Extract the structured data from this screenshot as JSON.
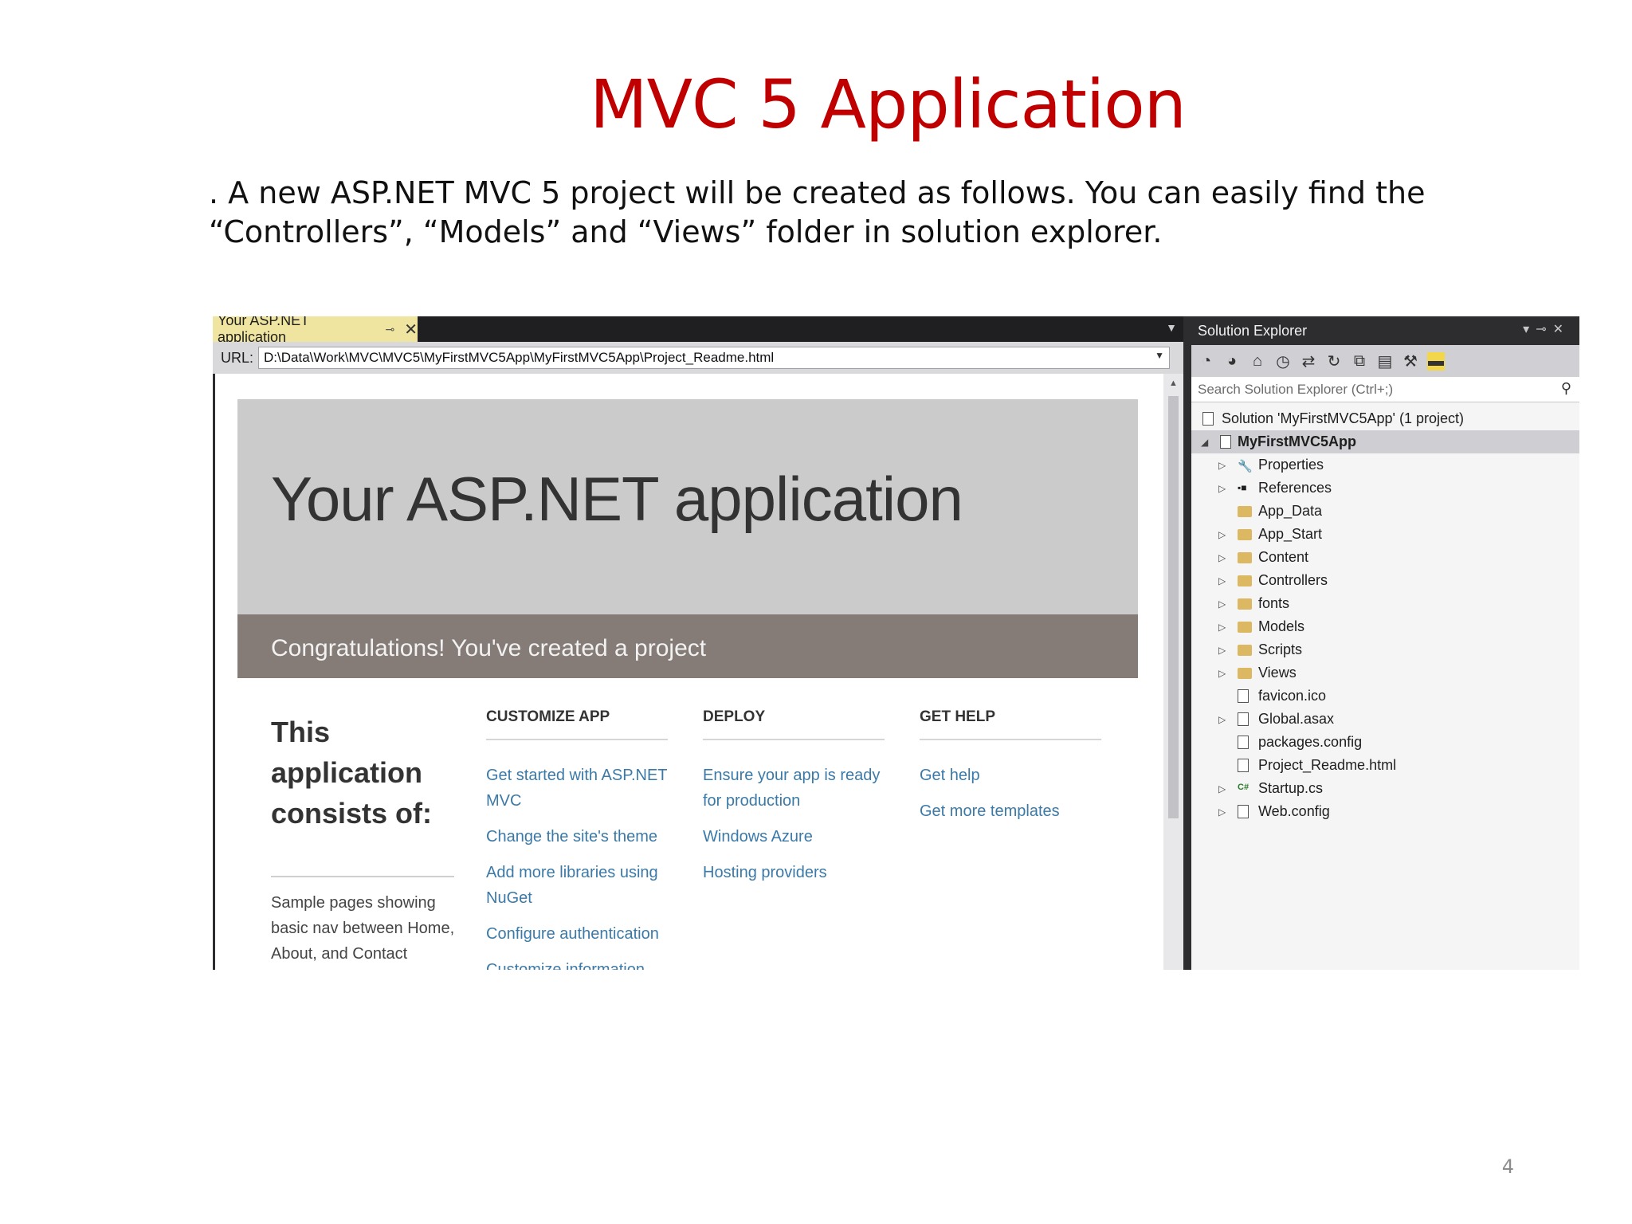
{
  "slide": {
    "title": "MVC 5 Application",
    "body_line1": ". A new ASP.NET MVC 5 project will be created as follows. You can easily find the",
    "body_line2": "“Controllers”, “Models” and “Views” folder in solution explorer.",
    "page_number": "4"
  },
  "document": {
    "tab_label": "Your ASP.NET application",
    "url_label": "URL:",
    "url_value": "D:\\Data\\Work\\MVC\\MVC5\\MyFirstMVC5App\\MyFirstMVC5App\\Project_Readme.html"
  },
  "page": {
    "hero_title": "Your ASP.NET application",
    "hero_subtitle": "Congratulations! You've created a project",
    "consists_title": "This application consists of:",
    "consists_desc": "Sample pages showing basic nav between Home, About, and Contact",
    "columns": [
      {
        "heading": "CUSTOMIZE APP",
        "links": [
          "Get started with ASP.NET MVC",
          "Change the site's theme",
          "Add more libraries using NuGet",
          "Configure authentication",
          "Customize information"
        ]
      },
      {
        "heading": "DEPLOY",
        "links": [
          "Ensure your app is ready for production",
          "Windows Azure",
          "Hosting providers"
        ]
      },
      {
        "heading": "GET HELP",
        "links": [
          "Get help",
          "Get more templates"
        ]
      }
    ]
  },
  "solution_explorer": {
    "title": "Solution Explorer",
    "search_placeholder": "Search Solution Explorer (Ctrl+;)",
    "solution_label": "Solution 'MyFirstMVC5App' (1 project)",
    "project_label": "MyFirstMVC5App",
    "items": [
      {
        "label": "Properties",
        "icon": "wrench-icon",
        "expandable": true
      },
      {
        "label": "References",
        "icon": "references-icon",
        "expandable": true
      },
      {
        "label": "App_Data",
        "icon": "folder-icon",
        "expandable": false
      },
      {
        "label": "App_Start",
        "icon": "folder-icon",
        "expandable": true
      },
      {
        "label": "Content",
        "icon": "folder-icon",
        "expandable": true
      },
      {
        "label": "Controllers",
        "icon": "folder-icon",
        "expandable": true
      },
      {
        "label": "fonts",
        "icon": "folder-icon",
        "expandable": true
      },
      {
        "label": "Models",
        "icon": "folder-icon",
        "expandable": true
      },
      {
        "label": "Scripts",
        "icon": "folder-icon",
        "expandable": true
      },
      {
        "label": "Views",
        "icon": "folder-icon",
        "expandable": true
      },
      {
        "label": "favicon.ico",
        "icon": "image-file-icon",
        "expandable": false
      },
      {
        "label": "Global.asax",
        "icon": "global-file-icon",
        "expandable": true
      },
      {
        "label": "packages.config",
        "icon": "config-file-icon",
        "expandable": false
      },
      {
        "label": "Project_Readme.html",
        "icon": "html-file-icon",
        "expandable": false
      },
      {
        "label": "Startup.cs",
        "icon": "csharp-file-icon",
        "expandable": true
      },
      {
        "label": "Web.config",
        "icon": "config-file-icon",
        "expandable": true
      }
    ]
  },
  "colors": {
    "title_red": "#c00000",
    "tab_active": "#efe4a0",
    "link_blue": "#3b7aa8",
    "hero_bg": "#cbcbcb",
    "hero_sub_bg": "#857c78"
  }
}
